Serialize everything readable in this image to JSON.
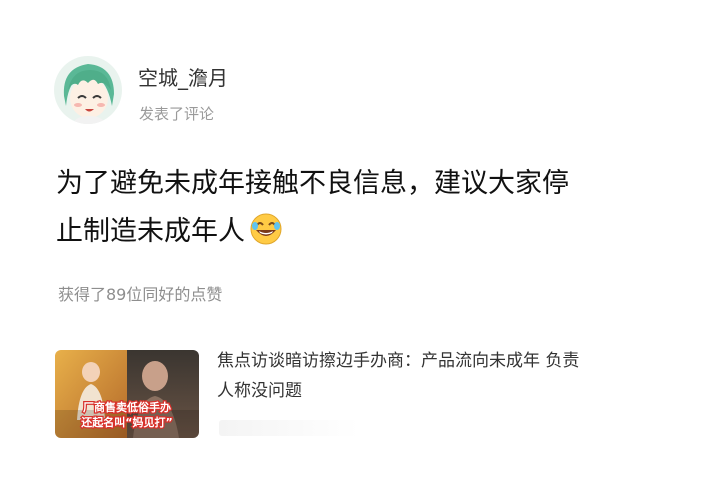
{
  "post": {
    "username": "空城_澹月",
    "action": "发表了评论",
    "comment_line1": "为了避免未成年接触不良信息，建议大家停",
    "comment_line2": "止制造未成年人",
    "emoji_name": "laughing-emoji",
    "likes_text": "获得了89位同好的点赞"
  },
  "article": {
    "title_line1": "焦点访谈暗访擦边手办商：产品流向未成年 负责",
    "title_line2": "人称没问题",
    "thumbnail_caption_line1": "厂商售卖低俗手办",
    "thumbnail_caption_line2": "还起名叫“妈见打”"
  },
  "colors": {
    "text_primary": "#111111",
    "text_secondary": "#9a9a9a",
    "thumb_caption_fill": "#ffffff",
    "thumb_caption_stroke": "#d8302a"
  }
}
